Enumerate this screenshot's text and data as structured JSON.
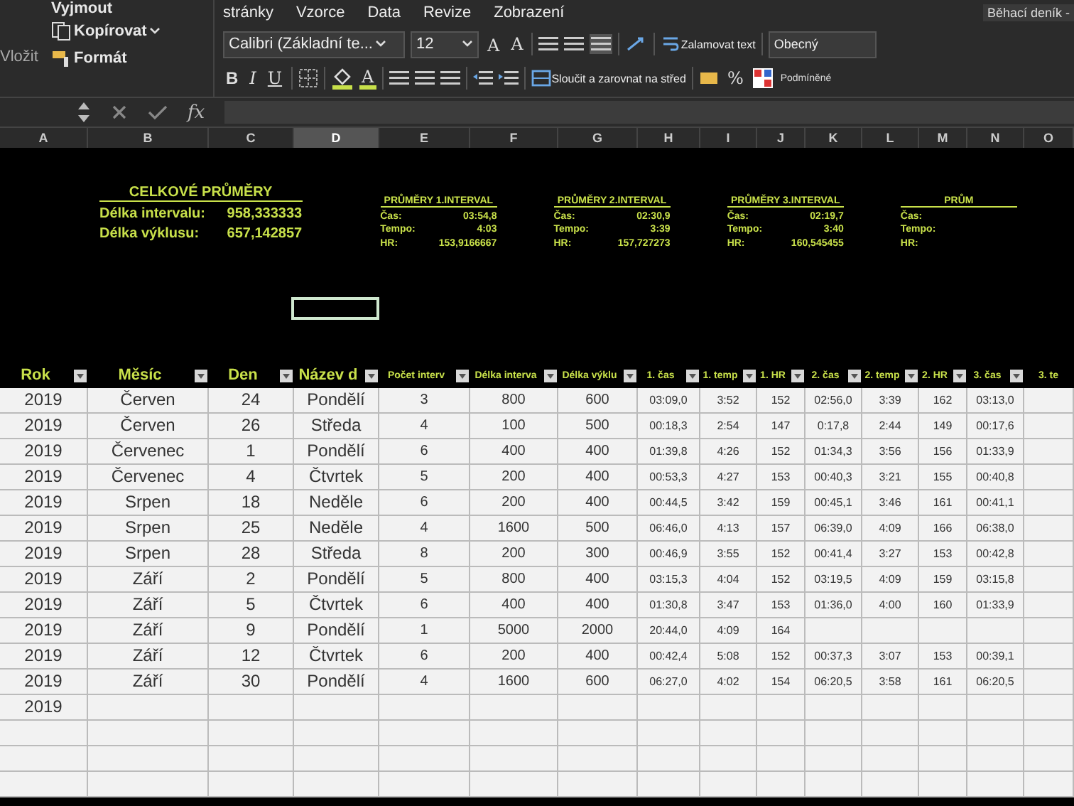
{
  "ribbon": {
    "clipboard": {
      "cut": "Vyjmout",
      "copy": "Kopírovat",
      "format": "Formát",
      "paste": "Vložit"
    },
    "tabs": [
      {
        "label": "stránky",
        "selected": false
      },
      {
        "label": "Vzorce",
        "selected": false
      },
      {
        "label": "Data",
        "selected": false
      },
      {
        "label": "Revize",
        "selected": false
      },
      {
        "label": "Zobrazení",
        "selected": false
      }
    ],
    "font": {
      "name": "Calibri (Základní te...",
      "size": "12",
      "grow": "A",
      "shrink": "A",
      "bold": "B",
      "italic": "I",
      "underline": "U",
      "text_color_button": "A"
    },
    "wrap_text": "Zalamovat text",
    "merge": "Sloučit a zarovnat na střed",
    "number_format": "Obecný",
    "percent": "%",
    "conditional": "Podmíněné",
    "document_title": "Běhací deník -"
  },
  "formula_bar": {
    "fx": "fx"
  },
  "columns": [
    {
      "letter": "A",
      "selected": false
    },
    {
      "letter": "B",
      "selected": false
    },
    {
      "letter": "C",
      "selected": false
    },
    {
      "letter": "D",
      "selected": true
    },
    {
      "letter": "E",
      "selected": false
    },
    {
      "letter": "F",
      "selected": false
    },
    {
      "letter": "G",
      "selected": false
    },
    {
      "letter": "H",
      "selected": false
    },
    {
      "letter": "I",
      "selected": false
    },
    {
      "letter": "J",
      "selected": false
    },
    {
      "letter": "K",
      "selected": false
    },
    {
      "letter": "L",
      "selected": false
    },
    {
      "letter": "M",
      "selected": false
    },
    {
      "letter": "N",
      "selected": false
    },
    {
      "letter": "O",
      "selected": false
    }
  ],
  "summaries": [
    {
      "kind": "main",
      "title": "CELKOVÉ PRŮMĚRY",
      "rows": [
        {
          "label": "Délka intervalu:",
          "value": "958,333333"
        },
        {
          "label": "Délka výklusu:",
          "value": "657,142857"
        }
      ]
    },
    {
      "kind": "interval",
      "title": "PRŮMĚRY 1.INTERVAL",
      "rows": [
        {
          "label": "Čas:",
          "value": "03:54,8"
        },
        {
          "label": "Tempo:",
          "value": "4:03"
        },
        {
          "label": "HR:",
          "value": "153,9166667"
        }
      ]
    },
    {
      "kind": "interval",
      "title": "PRŮMĚRY 2.INTERVAL",
      "rows": [
        {
          "label": "Čas:",
          "value": "02:30,9"
        },
        {
          "label": "Tempo:",
          "value": "3:39"
        },
        {
          "label": "HR:",
          "value": "157,727273"
        }
      ]
    },
    {
      "kind": "interval",
      "title": "PRŮMĚRY 3.INTERVAL",
      "rows": [
        {
          "label": "Čas:",
          "value": "02:19,7"
        },
        {
          "label": "Tempo:",
          "value": "3:40"
        },
        {
          "label": "HR:",
          "value": "160,545455"
        }
      ]
    },
    {
      "kind": "interval",
      "title": "PRŮM",
      "rows": [
        {
          "label": "Čas:"
        },
        {
          "label": "Tempo:"
        },
        {
          "label": "HR:"
        }
      ]
    }
  ],
  "table": {
    "columns": [
      "Rok",
      "Měsíc",
      "Den",
      "Název d",
      "Počet interv",
      "Délka interva",
      "Délka výklu",
      "1. čas",
      "1. temp",
      "1. HR",
      "2. čas",
      "2. temp",
      "2. HR",
      "3. čas",
      "3. te"
    ],
    "rows": [
      [
        "2019",
        "Červen",
        "24",
        "Pondělí",
        "3",
        "800",
        "600",
        "03:09,0",
        "3:52",
        "152",
        "02:56,0",
        "3:39",
        "162",
        "03:13,0",
        null
      ],
      [
        "2019",
        "Červen",
        "26",
        "Středa",
        "4",
        "100",
        "500",
        "00:18,3",
        "2:54",
        "147",
        "0:17,8",
        "2:44",
        "149",
        "00:17,6",
        null
      ],
      [
        "2019",
        "Červenec",
        "1",
        "Pondělí",
        "6",
        "400",
        "400",
        "01:39,8",
        "4:26",
        "152",
        "01:34,3",
        "3:56",
        "156",
        "01:33,9",
        null
      ],
      [
        "2019",
        "Červenec",
        "4",
        "Čtvrtek",
        "5",
        "200",
        "400",
        "00:53,3",
        "4:27",
        "153",
        "00:40,3",
        "3:21",
        "155",
        "00:40,8",
        null
      ],
      [
        "2019",
        "Srpen",
        "18",
        "Neděle",
        "6",
        "200",
        "400",
        "00:44,5",
        "3:42",
        "159",
        "00:45,1",
        "3:46",
        "161",
        "00:41,1",
        null
      ],
      [
        "2019",
        "Srpen",
        "25",
        "Neděle",
        "4",
        "1600",
        "500",
        "06:46,0",
        "4:13",
        "157",
        "06:39,0",
        "4:09",
        "166",
        "06:38,0",
        null
      ],
      [
        "2019",
        "Srpen",
        "28",
        "Středa",
        "8",
        "200",
        "300",
        "00:46,9",
        "3:55",
        "152",
        "00:41,4",
        "3:27",
        "153",
        "00:42,8",
        null
      ],
      [
        "2019",
        "Září",
        "2",
        "Pondělí",
        "5",
        "800",
        "400",
        "03:15,3",
        "4:04",
        "152",
        "03:19,5",
        "4:09",
        "159",
        "03:15,8",
        null
      ],
      [
        "2019",
        "Září",
        "5",
        "Čtvrtek",
        "6",
        "400",
        "400",
        "01:30,8",
        "3:47",
        "153",
        "01:36,0",
        "4:00",
        "160",
        "01:33,9",
        null
      ],
      [
        "2019",
        "Září",
        "9",
        "Pondělí",
        "1",
        "5000",
        "2000",
        "20:44,0",
        "4:09",
        "164",
        null,
        null,
        null,
        null,
        null
      ],
      [
        "2019",
        "Září",
        "12",
        "Čtvrtek",
        "6",
        "200",
        "400",
        "00:42,4",
        "5:08",
        "152",
        "00:37,3",
        "3:07",
        "153",
        "00:39,1",
        null
      ],
      [
        "2019",
        "Září",
        "30",
        "Pondělí",
        "4",
        "1600",
        "600",
        "06:27,0",
        "4:02",
        "154",
        "06:20,5",
        "3:58",
        "161",
        "06:20,5",
        null
      ],
      [
        "2019",
        null,
        null,
        null,
        null,
        null,
        null,
        null,
        null,
        null,
        null,
        null,
        null,
        null,
        null
      ]
    ]
  }
}
